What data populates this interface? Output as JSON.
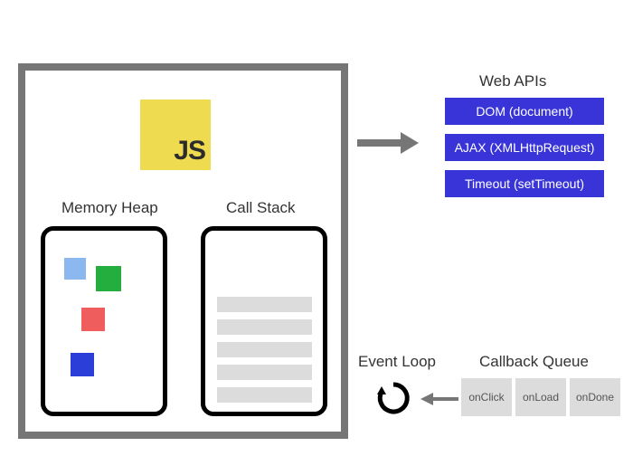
{
  "engine": {
    "logo_text": "JS",
    "heap_label": "Memory Heap",
    "stack_label": "Call Stack"
  },
  "web_apis": {
    "title": "Web APIs",
    "items": [
      "DOM (document)",
      "AJAX (XMLHttpRequest)",
      "Timeout (setTimeout)"
    ]
  },
  "event_loop": {
    "label": "Event Loop"
  },
  "callback_queue": {
    "label": "Callback Queue",
    "items": [
      "onClick",
      "onLoad",
      "onDone"
    ]
  }
}
